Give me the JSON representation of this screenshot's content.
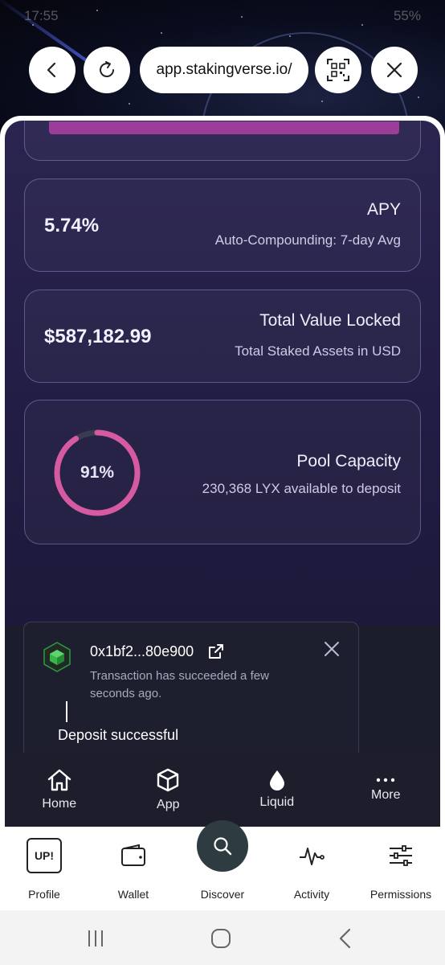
{
  "status_bar": {
    "time": "17:55",
    "right": "55%"
  },
  "browser": {
    "url": "app.stakingverse.io/"
  },
  "apy": {
    "value": "5.74%",
    "title": "APY",
    "subtitle": "Auto-Compounding: 7-day Avg"
  },
  "tvl": {
    "value": "$587,182.99",
    "title": "Total Value Locked",
    "subtitle": "Total Staked Assets in USD"
  },
  "capacity": {
    "percent_label": "91%",
    "percent": 0.91,
    "title": "Pool Capacity",
    "subtitle": "230,368 LYX available to deposit",
    "ring_color": "#d65aa2"
  },
  "toast": {
    "hash": "0x1bf2...80e900",
    "message": "Transaction has succeeded a few seconds ago.",
    "status": "Deposit successful"
  },
  "web_nav": [
    {
      "label": "Home",
      "icon": "home-icon"
    },
    {
      "label": "App",
      "icon": "cube-icon"
    },
    {
      "label": "Liquid",
      "icon": "drop-icon"
    },
    {
      "label": "More",
      "icon": "more-dots-icon"
    }
  ],
  "app_nav": [
    {
      "label": "Profile",
      "icon": "up-profile-icon",
      "badge": "UP!"
    },
    {
      "label": "Wallet",
      "icon": "wallet-icon"
    },
    {
      "label": "Discover",
      "icon": "search-icon"
    },
    {
      "label": "Activity",
      "icon": "activity-icon"
    },
    {
      "label": "Permissions",
      "icon": "sliders-icon"
    }
  ]
}
